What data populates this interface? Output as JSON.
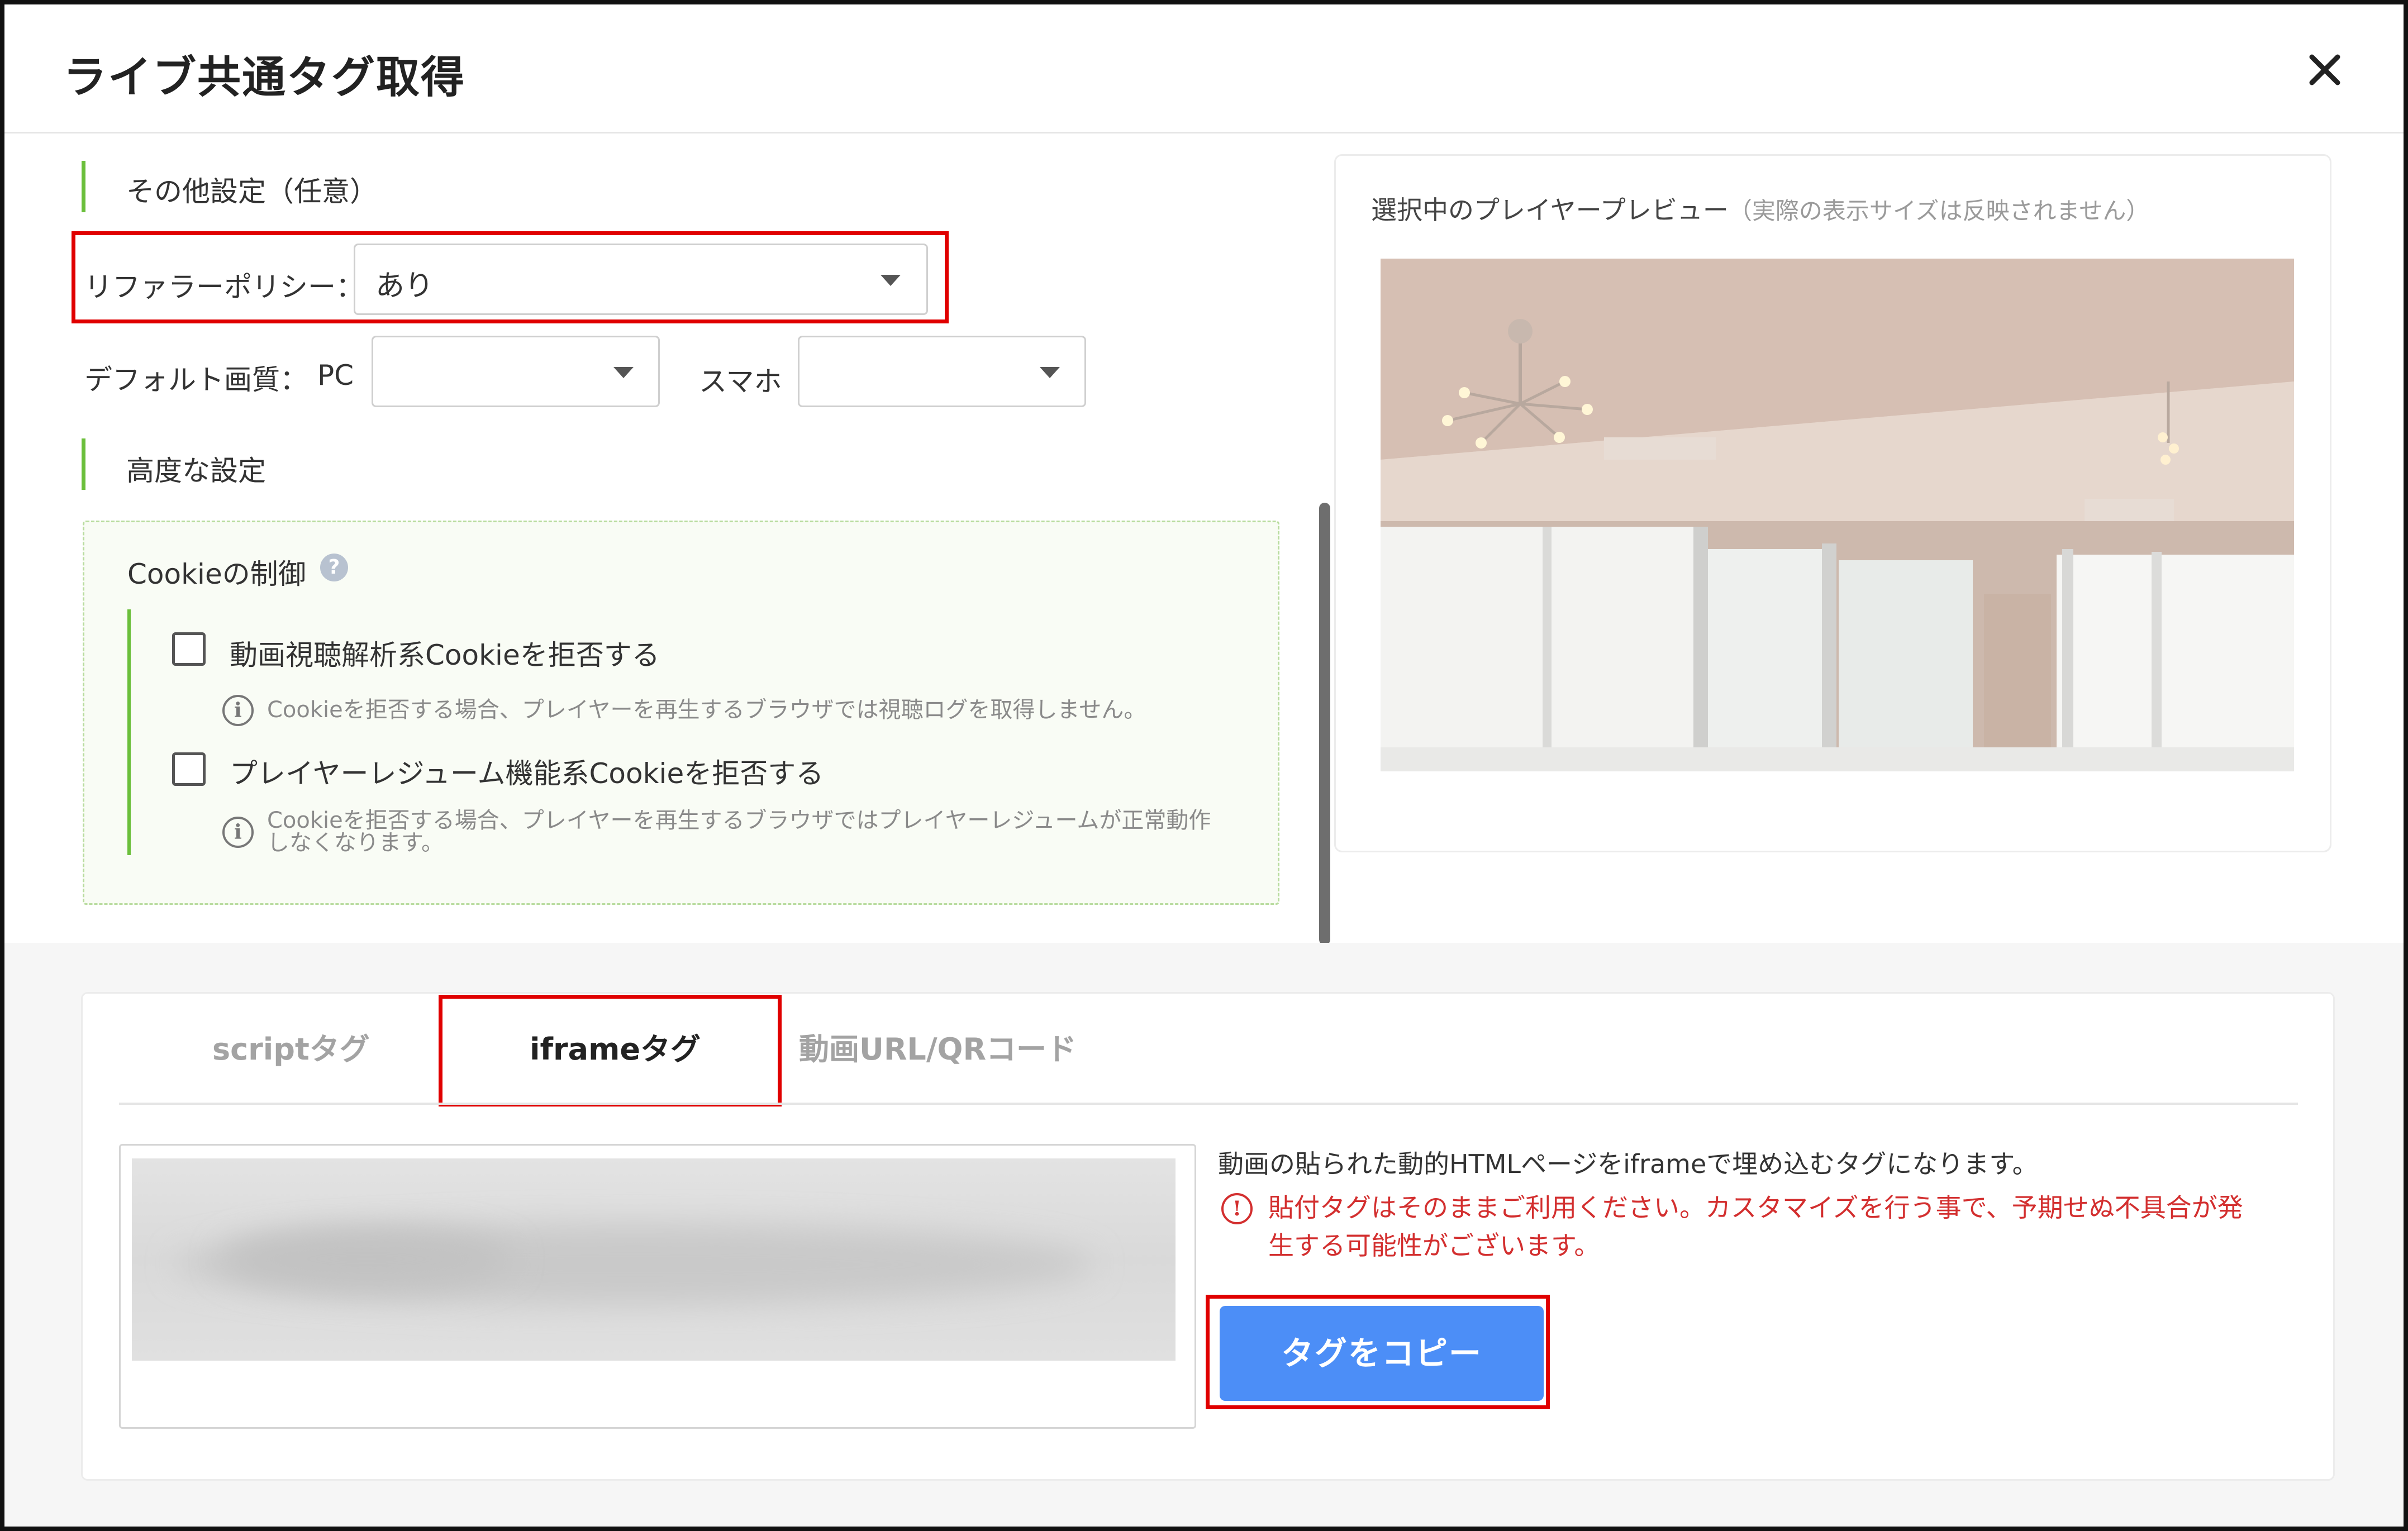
{
  "dialog": {
    "title": "ライブ共通タグ取得"
  },
  "settings": {
    "other_section_title": "その他設定（任意）",
    "referrer_policy": {
      "label": "リファラーポリシー：",
      "value": "あり"
    },
    "default_quality": {
      "label": "デフォルト画質：",
      "pc_label": "PC",
      "pc_value": "",
      "smartphone_label": "スマホ",
      "smartphone_value": ""
    },
    "advanced_section_title": "高度な設定",
    "cookie": {
      "title": "Cookieの制御",
      "options": [
        {
          "label": "動画視聴解析系Cookieを拒否する",
          "checked": false,
          "hint": [
            "Cookieを拒否する場合、プレイヤーを再生するブラウザでは視聴ログを取得しません。"
          ]
        },
        {
          "label": "プレイヤーレジューム機能系Cookieを拒否する",
          "checked": false,
          "hint": [
            "Cookieを拒否する場合、プレイヤーを再生するブラウザではプレイヤーレジュームが正常動作",
            "しなくなります。"
          ]
        }
      ]
    }
  },
  "preview": {
    "title": "選択中のプレイヤープレビュー",
    "subtitle": "（実際の表示サイズは反映されません）"
  },
  "tabs": [
    {
      "label": "scriptタグ",
      "active": false
    },
    {
      "label": "iframeタグ",
      "active": true
    },
    {
      "label": "動画URL/QRコード",
      "active": false
    }
  ],
  "tag_panel": {
    "description": "動画の貼られた動的HTMLページをiframeで埋め込むタグになります。",
    "warning_lines": [
      "貼付タグはそのままご利用ください。カスタマイズを行う事で、予期せぬ不具合が発",
      "生する可能性がございます。"
    ],
    "copy_button": "タグをコピー"
  },
  "icons": {
    "close": "close-icon",
    "help": "help-icon",
    "info": "info-icon",
    "warning": "warning-icon",
    "dropdown": "caret-down-icon"
  },
  "colors": {
    "accent_green": "#6bbf3b",
    "highlight_red": "#e00000",
    "button_blue": "#4c8ef7",
    "warning_red": "#d32f2f"
  }
}
